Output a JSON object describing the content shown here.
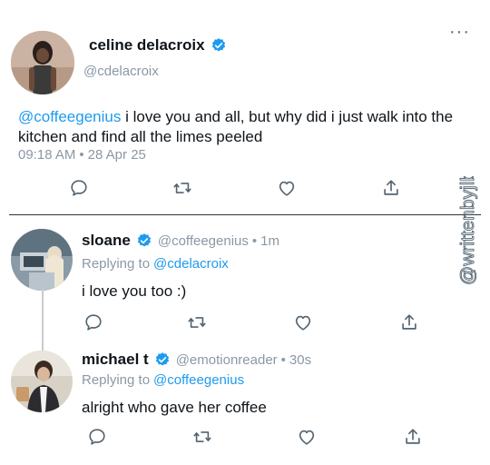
{
  "main_tweet": {
    "name": "celine delacroix",
    "handle": "@cdelacroix",
    "mention": "@coffeegenius",
    "text": " i love you and all, but why did i just walk into the kitchen and find all the limes peeled",
    "time": "09:18 AM",
    "date": "28 Apr 25",
    "more_glyph": "···"
  },
  "replies": [
    {
      "name": "sloane",
      "handle": "@coffeegenius",
      "age": "1m",
      "replying_label": "Replying to",
      "replying_to": "@cdelacroix",
      "text": "i love you too :)"
    },
    {
      "name": "michael t",
      "handle": "@emotionreader",
      "age": "30s",
      "replying_label": "Replying to",
      "replying_to": "@coffeegenius",
      "text": "alright who gave her coffee"
    }
  ],
  "watermark": "@writtenbyjlb",
  "colors": {
    "accent": "#1d9bf0",
    "muted": "#8b98a5",
    "text": "#0f1419",
    "divider": "#2f3336"
  },
  "icons": [
    "reply-icon",
    "retweet-icon",
    "like-icon",
    "share-icon",
    "verified-badge-icon",
    "more-icon"
  ]
}
